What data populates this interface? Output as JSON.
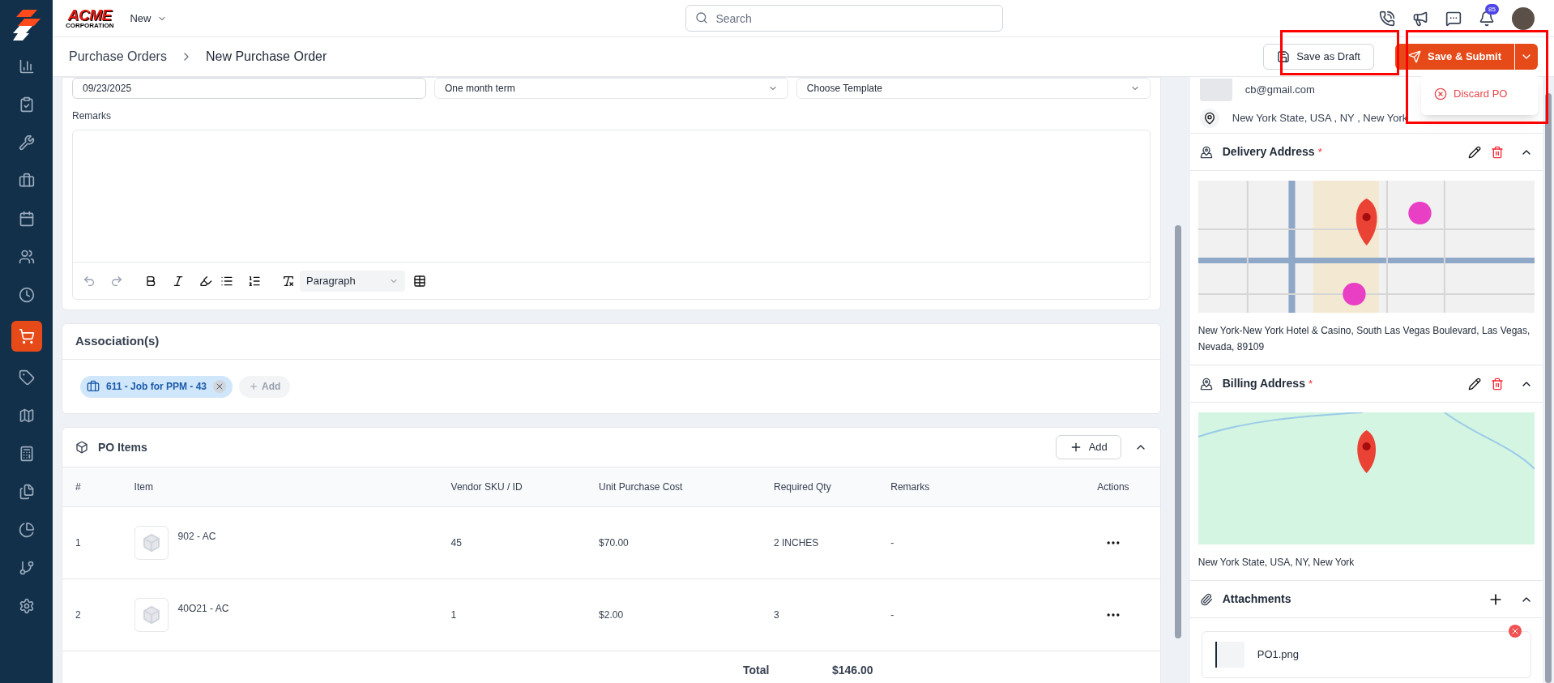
{
  "sidebar": {
    "items": [
      {
        "selected": false
      },
      {
        "selected": false
      },
      {
        "selected": false
      },
      {
        "selected": false
      },
      {
        "selected": false
      },
      {
        "selected": false
      },
      {
        "selected": false
      },
      {
        "selected": true
      },
      {
        "selected": false
      },
      {
        "selected": false
      },
      {
        "selected": false
      },
      {
        "selected": false
      },
      {
        "selected": false
      },
      {
        "selected": false
      },
      {
        "selected": false
      }
    ]
  },
  "topbar": {
    "logo_main": "ACME",
    "logo_sub": "CORPORATION",
    "new_menu": "New",
    "search": {
      "placeholder": "Search"
    },
    "notification_count": "85"
  },
  "breadcrumb": [
    "Purchase Orders",
    "New Purchase Order"
  ],
  "actions": {
    "draft": "Save as Draft",
    "submit": "Save & Submit",
    "menu": [
      {
        "label": "Discard PO"
      }
    ]
  },
  "form": {
    "date": "09/23/2025",
    "term": "One month term",
    "template": "Choose Template",
    "remarks_label": "Remarks",
    "block_style": "Paragraph"
  },
  "associations": {
    "title": "Association(s)",
    "chips": [
      "611 - Job for PPM - 43"
    ],
    "add": "Add"
  },
  "po_items": {
    "title": "PO Items",
    "add": "Add",
    "columns": [
      "#",
      "Item",
      "Vendor SKU / ID",
      "Unit Purchase Cost",
      "Required Qty",
      "Remarks",
      "Actions"
    ],
    "rows": [
      {
        "num": "1",
        "item": "902 - AC",
        "sku": "45",
        "cost": "$70.00",
        "qty": "2 INCHES",
        "remarks": "-"
      },
      {
        "num": "2",
        "item": "40O21 - AC",
        "sku": "1",
        "cost": "$2.00",
        "qty": "3",
        "remarks": "-"
      }
    ],
    "total_label": "Total",
    "total": "$146.00"
  },
  "side": {
    "email": "cb@gmail.com",
    "location": "New York State, USA , NY , New York",
    "delivery": {
      "title": "Delivery Address",
      "required_mark": "*",
      "address": "New York-New York Hotel & Casino, South Las Vegas Boulevard, Las Vegas, Nevada, 89109"
    },
    "billing": {
      "title": "Billing Address",
      "required_mark": "*",
      "address": "New York State, USA, NY, New York"
    },
    "attachments": {
      "title": "Attachments",
      "files": [
        "PO1.png"
      ]
    }
  }
}
